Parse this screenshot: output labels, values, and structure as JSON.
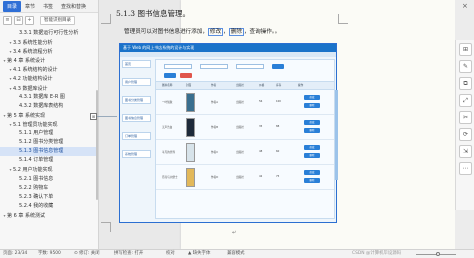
{
  "nav": {
    "tabs": [
      {
        "label": "目录",
        "active": true
      },
      {
        "label": "章节",
        "active": false
      },
      {
        "label": "书签",
        "active": false
      },
      {
        "label": "查找和替换",
        "active": false
      }
    ],
    "smart_toc_label": "智能识别目录",
    "outline": [
      {
        "label": "3.3.1 数据运行可行性分析",
        "level": 3
      },
      {
        "label": "3.3 系统性能分析",
        "level": 2
      },
      {
        "label": "3.4 系统流程分析",
        "level": 2
      },
      {
        "label": "第 4 章 系统设计",
        "level": 1
      },
      {
        "label": "4.1 系统结构的设计",
        "level": 2
      },
      {
        "label": "4.2 功能结构设计",
        "level": 2
      },
      {
        "label": "4.3 数据库设计",
        "level": 2
      },
      {
        "label": "4.3.1 数据库 E-R 图",
        "level": 3
      },
      {
        "label": "4.3.2 数据库表结构",
        "level": 3
      },
      {
        "label": "第 5 章 系统实现",
        "level": 1
      },
      {
        "label": "5.1 管理员功能实现",
        "level": 2
      },
      {
        "label": "5.1.1 用户管理",
        "level": 3
      },
      {
        "label": "5.1.2 图书分类管理",
        "level": 3
      },
      {
        "label": "5.1.3 图书信息管理",
        "level": 3,
        "selected": true
      },
      {
        "label": "5.1.4 订单管理",
        "level": 3
      },
      {
        "label": "5.2 用户功能实现",
        "level": 2
      },
      {
        "label": "5.2.1 图书信息",
        "level": 3
      },
      {
        "label": "5.2.2 购物车",
        "level": 3
      },
      {
        "label": "5.2.3 确认下单",
        "level": 3
      },
      {
        "label": "5.2.4 我的收藏",
        "level": 3
      },
      {
        "label": "第 6 章 系统测试",
        "level": 1
      }
    ]
  },
  "document": {
    "heading": "5.1.3 图书信息管理。",
    "body_pre": "管理员可以对图书信息进行添加，",
    "body_hl_1": "修改",
    "body_mid": "，",
    "body_hl_2": "删除",
    "body_post": "，查询操作。。",
    "caption_mark": "↵"
  },
  "embedded": {
    "title": "基于 Web 的网上书店系统的设计与实现",
    "sidebar_items": [
      "首页",
      "用户管理",
      "图书分类管理",
      "图书信息管理",
      "订单管理",
      "系统管理"
    ],
    "columns": [
      "图书名称",
      "封面",
      "作者",
      "出版社",
      "价格",
      "库存",
      "操作"
    ],
    "rows": [
      {
        "name": "一叶知秋",
        "author": "作者A",
        "publisher": "出版社",
        "price": "56",
        "stock": "100",
        "cover": "#3a6f8f"
      },
      {
        "name": "无声告白",
        "author": "作者B",
        "publisher": "出版社",
        "price": "35",
        "stock": "88",
        "cover": "#1e2a3a"
      },
      {
        "name": "平凡的世界",
        "author": "作者C",
        "publisher": "出版社",
        "price": "48",
        "stock": "60",
        "cover": "#d7e3ea"
      },
      {
        "name": "月亮与六便士",
        "author": "作者D",
        "publisher": "出版社",
        "price": "42",
        "stock": "75",
        "cover": "#e2b85a"
      }
    ],
    "action_edit": "修改",
    "action_delete": "删除"
  },
  "right_toolbar": [
    "⊞",
    "✎",
    "⧉",
    "⤢",
    "✂",
    "⟳",
    "⇲",
    "⋯"
  ],
  "status": {
    "page": "页面: 23/34",
    "words": "字数: 9500",
    "track": "⊙ 修订: 关闭",
    "spell": "拼写检查: 打开",
    "proof": "校对",
    "font_missing": "▲ 缺失字体",
    "compat": "兼容模式",
    "watermark": "CSDN @计算机毕设源码"
  },
  "colors": {
    "accent": "#2f6fd6",
    "selected_bg": "#d6e3f7",
    "embedded_header": "#1a73c9"
  }
}
